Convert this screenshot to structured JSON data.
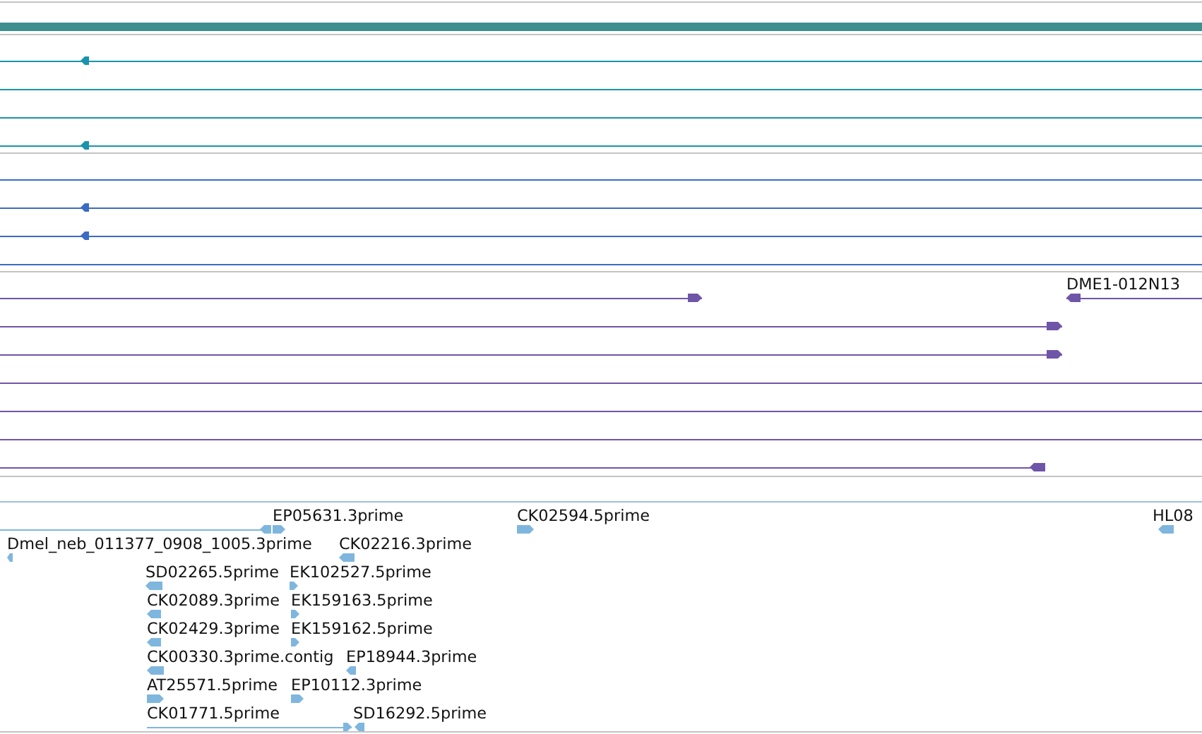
{
  "tracks": [
    {
      "color": "#1a93ad",
      "rows": [
        {
          "features": [
            {
              "kind": "reverse"
            }
          ]
        },
        {
          "features": [
            {
              "kind": "plain"
            }
          ]
        },
        {
          "features": [
            {
              "kind": "plain"
            }
          ]
        },
        {
          "features": [
            {
              "kind": "reverse"
            }
          ]
        }
      ]
    },
    {
      "color": "#3b6bc4",
      "rows": [
        {
          "features": [
            {
              "kind": "plain"
            }
          ]
        },
        {
          "features": [
            {
              "kind": "reverse"
            }
          ]
        },
        {
          "features": [
            {
              "kind": "reverse"
            }
          ]
        },
        {
          "features": [
            {
              "kind": "plain"
            }
          ]
        }
      ]
    },
    {
      "color": "#6f55a8",
      "rows": [
        {
          "features": [
            {
              "kind": "forward"
            },
            {
              "kind": "reverse",
              "label": "DME1-012N13"
            }
          ]
        },
        {
          "features": [
            {
              "kind": "forward"
            }
          ]
        },
        {
          "features": [
            {
              "kind": "forward"
            }
          ]
        },
        {
          "features": [
            {
              "kind": "plain"
            }
          ]
        },
        {
          "features": [
            {
              "kind": "plain"
            }
          ]
        },
        {
          "features": [
            {
              "kind": "plain"
            }
          ]
        },
        {
          "features": [
            {
              "kind": "reverse"
            }
          ]
        }
      ]
    },
    {
      "color": "#7fb6de",
      "rows": [
        {
          "features": [
            {
              "kind": "reverse"
            },
            {
              "kind": "forward",
              "label": "EP05631.3prime"
            },
            {
              "kind": "forward",
              "label": "CK02594.5prime"
            },
            {
              "kind": "reverse",
              "label": "HL08"
            }
          ]
        },
        {
          "features": [
            {
              "kind": "reverse",
              "label": "Dmel_neb_011377_0908_1005.3prime"
            },
            {
              "kind": "reverse",
              "label": "CK02216.3prime"
            }
          ]
        },
        {
          "features": [
            {
              "kind": "reverse",
              "label": "SD02265.5prime"
            },
            {
              "kind": "forward",
              "label": "EK102527.5prime"
            }
          ]
        },
        {
          "features": [
            {
              "kind": "reverse",
              "label": "CK02089.3prime"
            },
            {
              "kind": "forward",
              "label": "EK159163.5prime"
            }
          ]
        },
        {
          "features": [
            {
              "kind": "reverse",
              "label": "CK02429.3prime"
            },
            {
              "kind": "forward",
              "label": "EK159162.5prime"
            }
          ]
        },
        {
          "features": [
            {
              "kind": "reverse",
              "label": "CK00330.3prime.contig"
            },
            {
              "kind": "reverse",
              "label": "EP18944.3prime"
            }
          ]
        },
        {
          "features": [
            {
              "kind": "forward",
              "label": "AT25571.5prime"
            },
            {
              "kind": "forward",
              "label": "EP10112.3prime"
            }
          ]
        },
        {
          "features": [
            {
              "kind": "forward",
              "label": "CK01771.5prime"
            },
            {
              "kind": "reverse",
              "label": "SD16292.5prime"
            }
          ]
        }
      ]
    }
  ]
}
